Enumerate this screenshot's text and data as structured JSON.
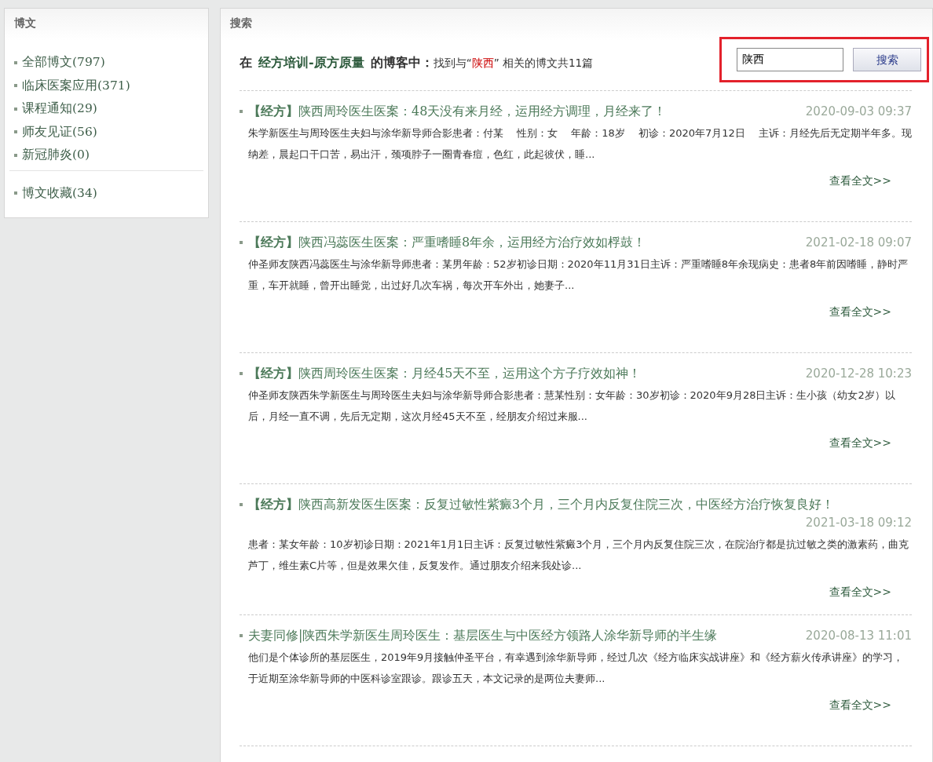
{
  "sidebar": {
    "title": "博文",
    "groups": [
      {
        "items": [
          {
            "label": "全部博文(797)"
          },
          {
            "label": "临床医案应用(371)"
          },
          {
            "label": "课程通知(29)"
          },
          {
            "label": "师友见证(56)"
          },
          {
            "label": "新冠肺炎(0)"
          }
        ]
      },
      {
        "items": [
          {
            "label": "博文收藏(34)"
          }
        ]
      }
    ]
  },
  "main": {
    "title": "搜索",
    "summary": {
      "prefix": "在",
      "blog_name": "经方培训-原方原量",
      "suffix": "的博客中：",
      "result_before": "找到与“",
      "keyword": "陕西",
      "result_after": "” 相关的博文共11篇"
    },
    "search": {
      "value": "陕西",
      "button": "搜索",
      "highlighted": true
    },
    "posts": [
      {
        "title": "**【经方】**陕西周玲医生医案：48天没有来月经，运用经方调理，月经来了！",
        "date": "2020-09-03 09:37",
        "excerpt": "朱学新医生与周玲医生夫妇与涂华新导师合影患者：付某　 性别：女　 年龄：18岁　 初诊：2020年7月12日　 主诉：月经先后无定期半年多。现纳差，晨起口干口苦，易出汗，颈项脖子一圈青春痘，色红，此起彼伏，睡...",
        "more": "查看全文>>"
      },
      {
        "title": "**【经方】**陕西冯蕊医生医案：严重嗜睡8年余，运用经方治疗效如桴鼓！",
        "date": "2021-02-18 09:07",
        "excerpt": "仲圣师友陕西冯蕊医生与涂华新导师患者：某男年龄：52岁初诊日期：2020年11月31日主诉：严重嗜睡8年余现病史：患者8年前因嗜睡，静时严重，车开就睡，曾开出睡觉，出过好几次车祸，每次开车外出，她妻子...",
        "more": "查看全文>>"
      },
      {
        "title": "**【经方】**陕西周玲医生医案：月经45天不至，运用这个方子疗效如神！",
        "date": "2020-12-28 10:23",
        "excerpt": "仲圣师友陕西朱学新医生与周玲医生夫妇与涂华新导师合影患者：慧某性别：女年龄：30岁初诊：2020年9月28日主诉：生小孩（幼女2岁）以后，月经一直不调，先后无定期，这次月经45天不至，经朋友介绍过来服...",
        "more": "查看全文>>"
      },
      {
        "title": "**【经方】**陕西高新发医生医案：反复过敏性紫癜3个月，三个月内反复住院三次，中医经方治疗恢复良好！",
        "date": "2021-03-18 09:12",
        "excerpt": "患者：某女年龄：10岁初诊日期：2021年1月1日主诉：反复过敏性紫癜3个月，三个月内反复住院三次，在院治疗都是抗过敏之类的激素药，曲克芦丁，维生素C片等，但是效果欠佳，反复发作。通过朋友介绍来我处诊...",
        "more": "查看全文>>"
      },
      {
        "title": "夫妻同修|陕西朱学新医生周玲医生：基层医生与中医经方领路人涂华新导师的半生缘",
        "date": "2020-08-13 11:01",
        "excerpt": "他们是个体诊所的基层医生，2019年9月接触仲圣平台，有幸遇到涂华新导师，经过几次《经方临床实战讲座》和《经方薪火传承讲座》的学习，于近期至涂华新导师的中医科诊室跟诊。跟诊五天，本文记录的是两位夫妻师...",
        "more": "查看全文>>"
      }
    ]
  }
}
